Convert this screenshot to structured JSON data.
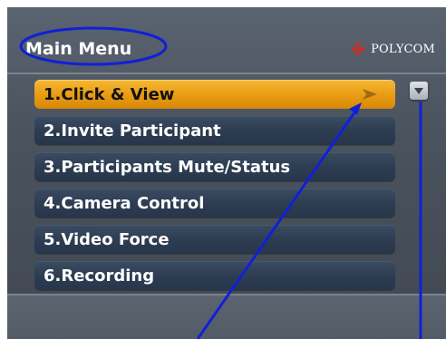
{
  "header": {
    "title": "Main Menu",
    "logo_text": "POLYCOM"
  },
  "menu": {
    "selected_index": 0,
    "items": [
      {
        "label": "1.Click & View"
      },
      {
        "label": "2.Invite Participant"
      },
      {
        "label": "3.Participants Mute/Status"
      },
      {
        "label": "4.Camera Control"
      },
      {
        "label": "5.Video Force"
      },
      {
        "label": "6.Recording"
      }
    ]
  },
  "icons": {
    "selected_arrow": "arrow-right-icon",
    "scroll_down": "scroll-down-icon",
    "logo": "polycom-logo-icon"
  },
  "colors": {
    "selected_bg": "#f0a81f",
    "item_bg": "#2e3e54",
    "annotation": "#1020d8",
    "logo_red": "#d9281c"
  }
}
